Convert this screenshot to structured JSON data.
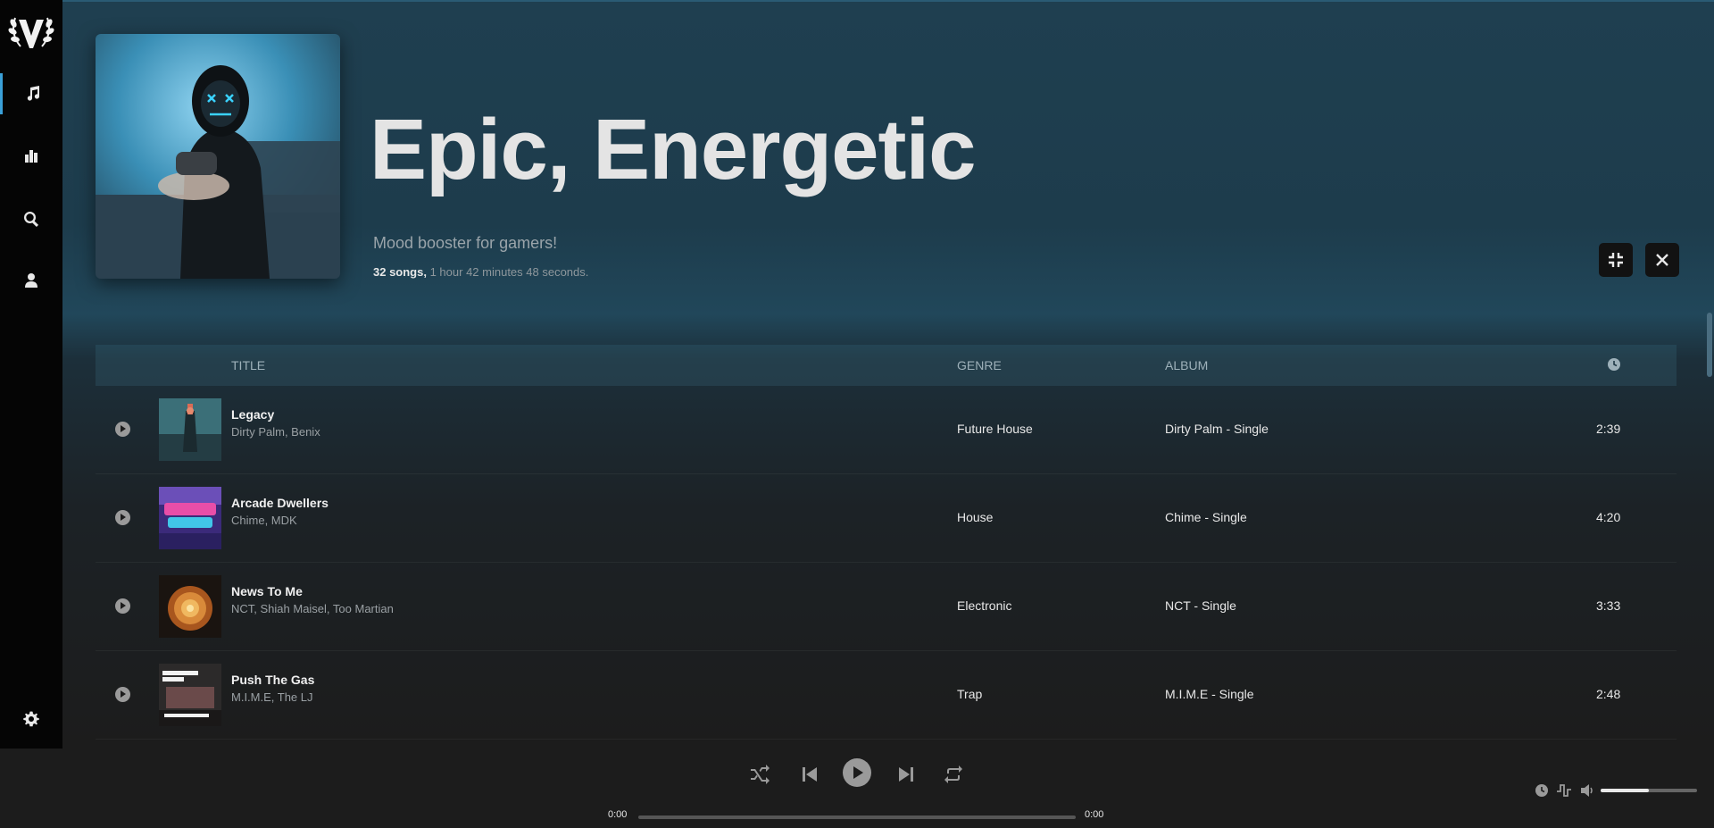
{
  "sidebar": {
    "items": [
      {
        "icon": "music-note-icon"
      },
      {
        "icon": "bar-chart-icon"
      },
      {
        "icon": "search-icon"
      },
      {
        "icon": "user-icon"
      }
    ],
    "settings_icon": "gear-icon",
    "logo": "laurel-v-logo"
  },
  "playlist": {
    "title": "Epic, Energetic",
    "description": "Mood booster for gamers!",
    "song_count": "32 songs,",
    "duration": "1 hour 42 minutes 48 seconds."
  },
  "table": {
    "headers": {
      "title": "TITLE",
      "genre": "GENRE",
      "album": "ALBUM",
      "duration_icon": "clock-icon"
    },
    "rows": [
      {
        "title": "Legacy",
        "artist": "Dirty Palm, Benix",
        "genre": "Future House",
        "album": "Dirty Palm - Single",
        "duration": "2:39"
      },
      {
        "title": "Arcade Dwellers",
        "artist": "Chime, MDK",
        "genre": "House",
        "album": "Chime - Single",
        "duration": "4:20"
      },
      {
        "title": "News To Me",
        "artist": "NCT, Shiah Maisel, Too Martian",
        "genre": "Electronic",
        "album": "NCT - Single",
        "duration": "3:33"
      },
      {
        "title": "Push The Gas",
        "artist": "M.I.M.E, The LJ",
        "genre": "Trap",
        "album": "M.I.M.E - Single",
        "duration": "2:48"
      }
    ]
  },
  "player": {
    "current_time": "0:00",
    "total_time": "0:00",
    "volume_level": 0.5
  },
  "colors": {
    "accent": "#3aa0d8",
    "header_bg": "#1f3f50",
    "sidebar_bg": "#050505",
    "player_bg": "#1c1c1c"
  }
}
